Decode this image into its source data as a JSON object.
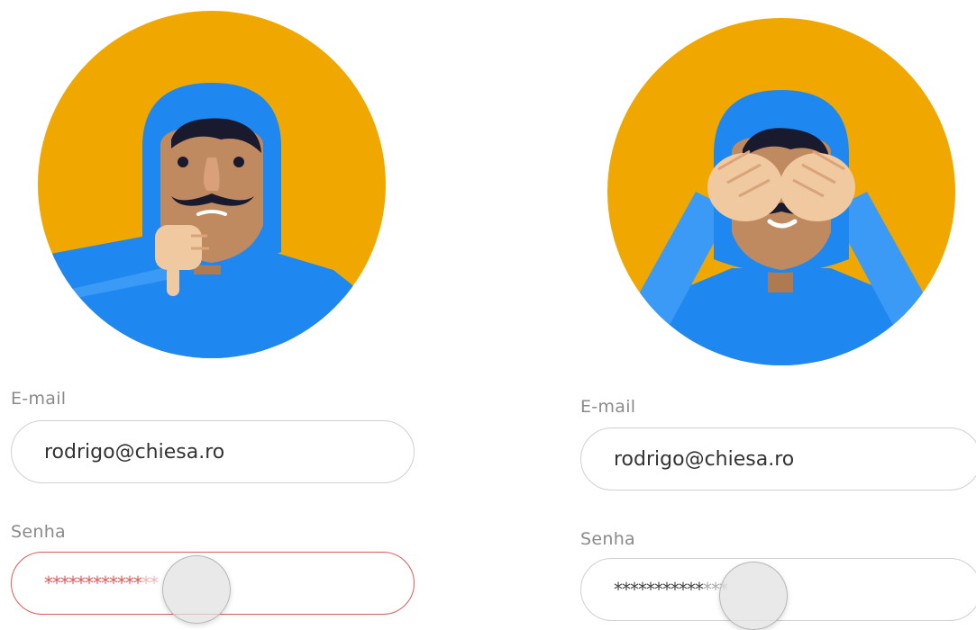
{
  "colors": {
    "avatar_bg": "#f0a800",
    "hoodie": "#1e88f0",
    "skin": "#c08a60",
    "hand": "#f0c9a0",
    "error_border": "#e05a5a"
  },
  "left_form": {
    "avatar_state": "password-error-thumbs-down",
    "email_label": "E-mail",
    "email_value": "rodrigo@chiesa.ro",
    "password_label": "Senha",
    "password_masked": "************",
    "password_masked_faded": "**",
    "password_state": "error"
  },
  "right_form": {
    "avatar_state": "typing-password-covering-eyes",
    "email_label": "E-mail",
    "email_value": "rodrigo@chiesa.ro",
    "password_label": "Senha",
    "password_masked": "***********",
    "password_masked_faded": "***",
    "password_state": "typing"
  }
}
